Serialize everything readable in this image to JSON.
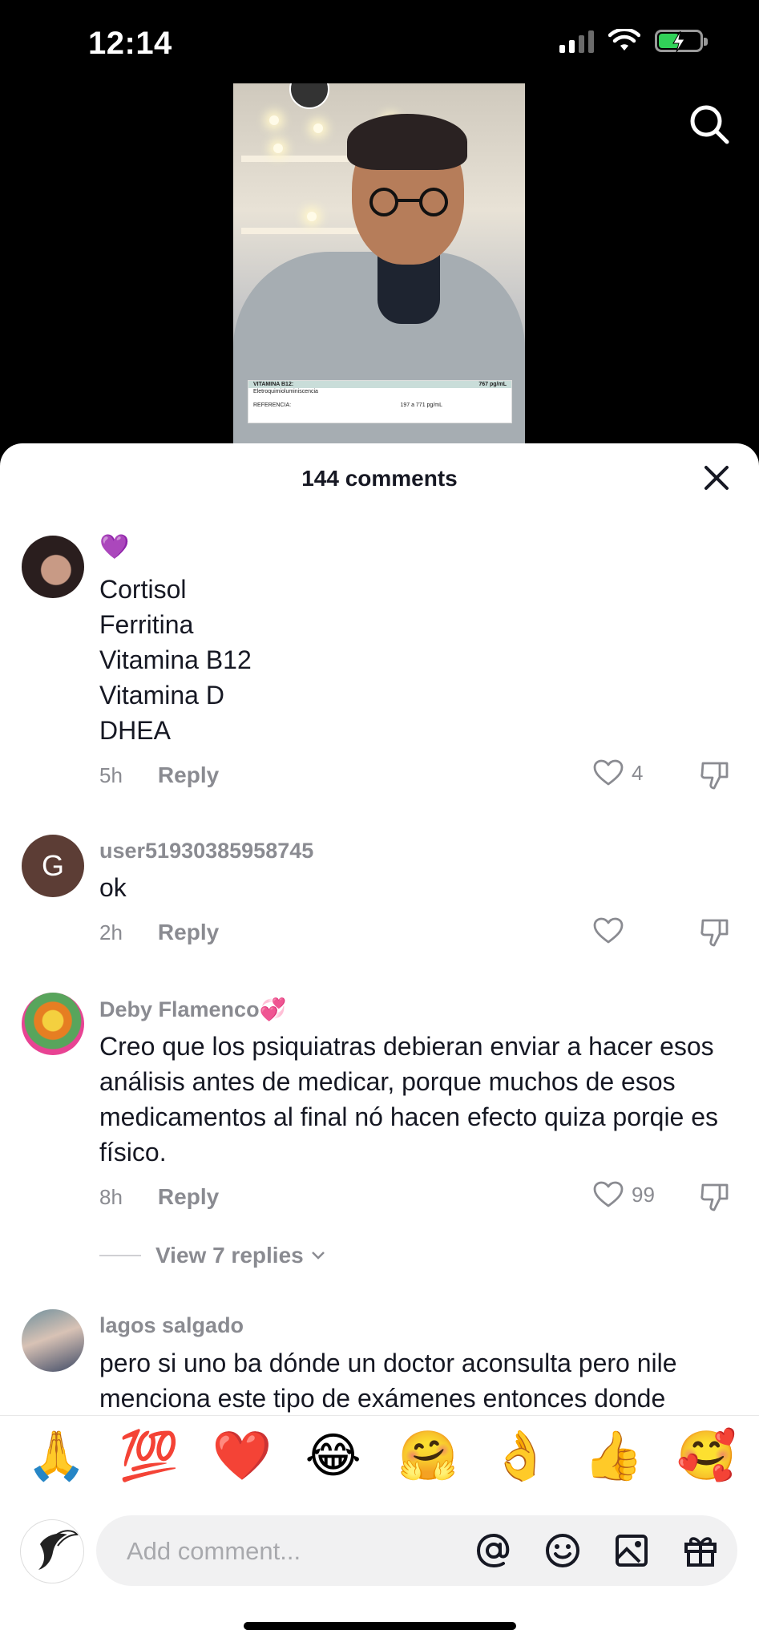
{
  "status_bar": {
    "time": "12:14",
    "battery_level": 0.5
  },
  "video": {
    "paper_lines": [
      "VITAMINA B12:",
      "767 pg/mL",
      "Eletroquimioluminiscencia",
      "REFERENCIA:",
      "197 a 771 pg/mL"
    ]
  },
  "icons": {
    "search": "search-icon",
    "close": "close-icon"
  },
  "comments_header": {
    "title": "144 comments"
  },
  "comments": [
    {
      "username": "",
      "emoji_badge": "💜",
      "text": "Cortisol\nFerritina\nVitamina B12\nVitamina D\nDHEA",
      "time": "5h",
      "reply_label": "Reply",
      "likes": "4"
    },
    {
      "username": "user51930385958745",
      "avatar_initial": "G",
      "text": "ok",
      "time": "2h",
      "reply_label": "Reply",
      "likes": ""
    },
    {
      "username": "Deby Flamenco💞",
      "text": "Creo que los psiquiatras debieran enviar a hacer esos análisis antes de medicar, porque muchos de esos medicamentos al final nó hacen efecto quiza porqie es físico.",
      "time": "8h",
      "reply_label": "Reply",
      "likes": "99",
      "view_replies": "View 7 replies"
    },
    {
      "username": "lagos salgado",
      "text": "pero si uno ba dónde un doctor aconsulta pero nile menciona este tipo de exámenes entonces donde"
    }
  ],
  "emoji_bar": [
    "🙏",
    "💯",
    "❤️",
    "😂",
    "🤗",
    "👌",
    "👍",
    "🥰"
  ],
  "comment_input": {
    "placeholder": "Add comment..."
  },
  "colors": {
    "secondary_text": "#8a8b91",
    "primary_text": "#161823",
    "input_bg": "#f1f1f2"
  }
}
